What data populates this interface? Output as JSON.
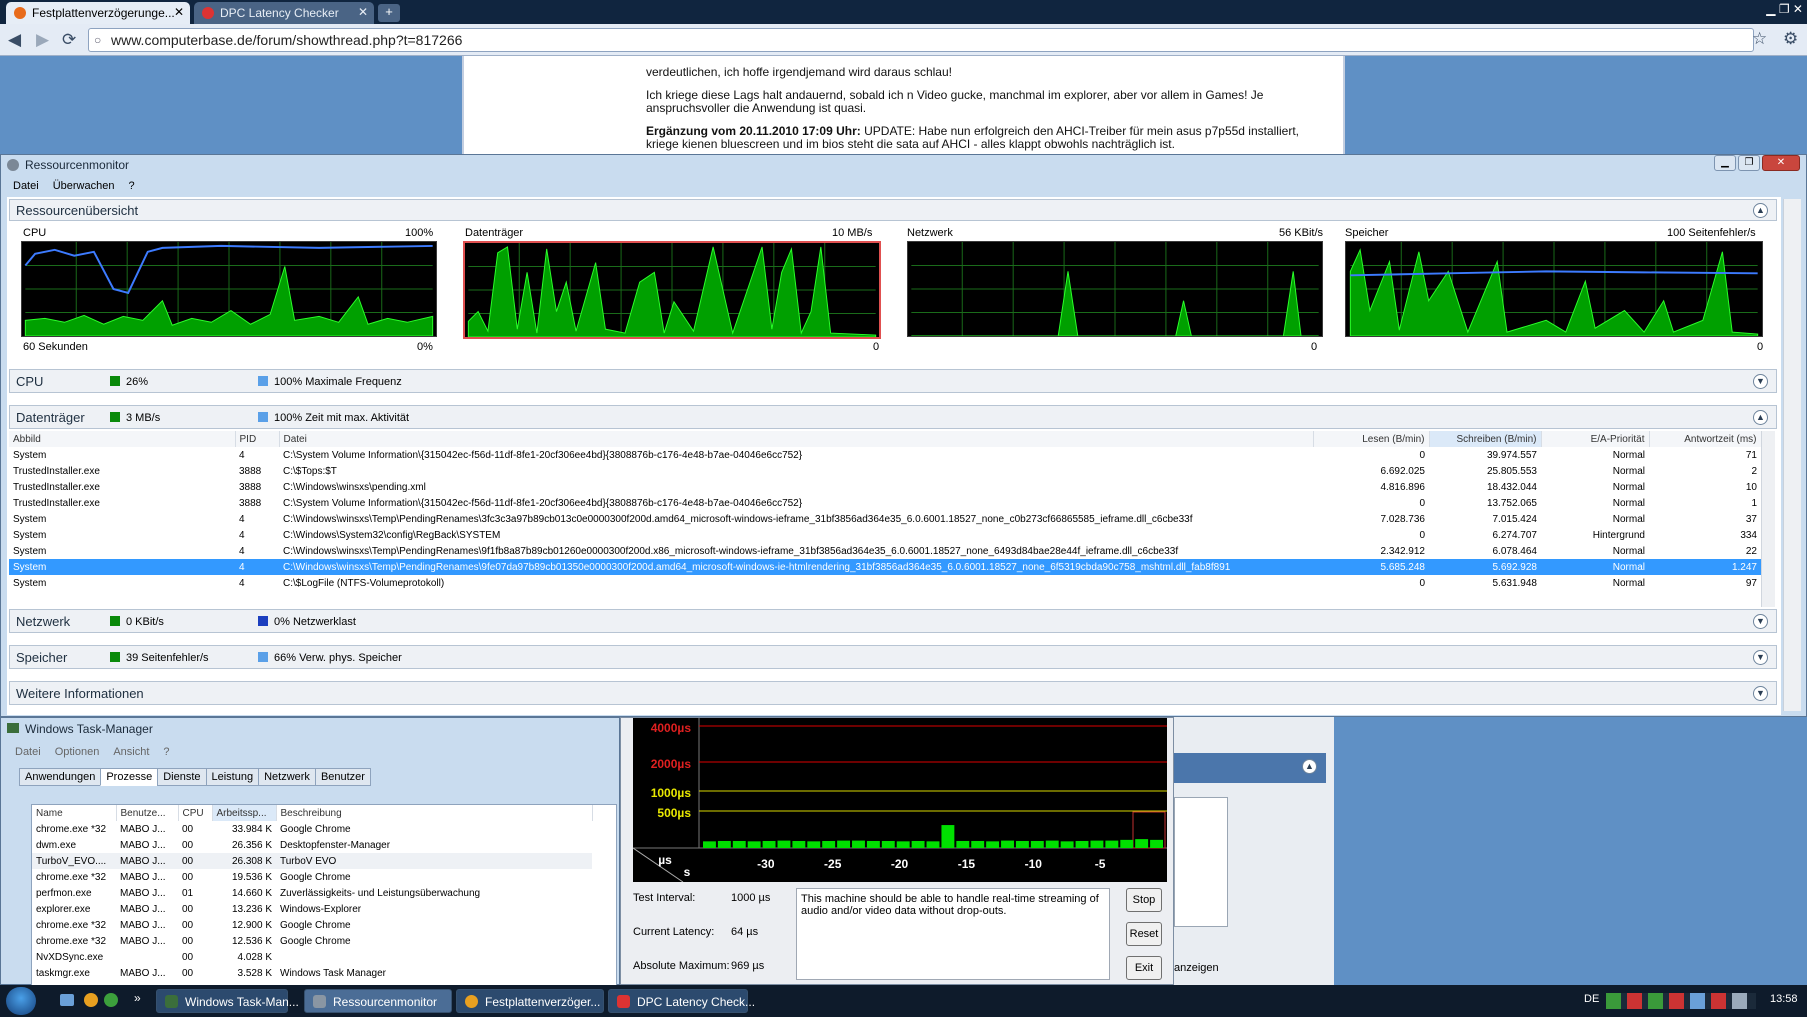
{
  "browser": {
    "tabs": [
      {
        "label": "Festplattenverzögerunge...",
        "active": true
      },
      {
        "label": "DPC Latency Checker",
        "active": false
      }
    ],
    "new_tab": "+",
    "url": "www.computerbase.de/forum/showthread.php?t=817266"
  },
  "forum": {
    "line1": "verdeutlichen, ich hoffe irgendjemand wird daraus schlau!",
    "para2": "Ich kriege diese Lags halt andauernd, sobald ich n Video gucke, manchmal im explorer, aber vor allem in Games! Je anspruchsvoller die Anwendung ist quasi.",
    "update_label": "Ergänzung vom 20.11.2010 17:09 Uhr:",
    "update_text": "UPDATE: Habe nun erfolgreich den AHCI-Treiber für mein asus p7p55d installiert, kriege kienen bluescreen und im bios steht die sata auf AHCI - alles klappt obwohls nachträglich ist."
  },
  "resmon": {
    "title": "Ressourcenmonitor",
    "menu": [
      "Datei",
      "Überwachen",
      "?"
    ],
    "overview_title": "Ressourcenübersicht",
    "graphs": [
      {
        "name": "CPU",
        "max": "100%",
        "footer_left": "60 Sekunden",
        "footer_right": "0%"
      },
      {
        "name": "Datenträger",
        "max": "10 MB/s",
        "footer_left": "",
        "footer_right": "0"
      },
      {
        "name": "Netzwerk",
        "max": "56 KBit/s",
        "footer_left": "",
        "footer_right": "0"
      },
      {
        "name": "Speicher",
        "max": "100 Seitenfehler/s",
        "footer_left": "",
        "footer_right": "0"
      }
    ],
    "cpu": {
      "title": "CPU",
      "stat1": "26%",
      "stat2": "100% Maximale Frequenz"
    },
    "disk": {
      "title": "Datenträger",
      "stat1": "3 MB/s",
      "stat2": "100% Zeit mit max. Aktivität",
      "columns": [
        "Abbild",
        "PID",
        "Datei",
        "Lesen (B/min)",
        "Schreiben (B/min)",
        "E/A-Priorität",
        "Antwortzeit (ms)"
      ],
      "rows": [
        [
          "System",
          "4",
          "C:\\System Volume Information\\{315042ec-f56d-11df-8fe1-20cf306ee4bd}{3808876b-c176-4e48-b7ae-04046e6cc752}",
          "0",
          "39.974.557",
          "Normal",
          "71"
        ],
        [
          "TrustedInstaller.exe",
          "3888",
          "C:\\$Tops:$T",
          "6.692.025",
          "25.805.553",
          "Normal",
          "2"
        ],
        [
          "TrustedInstaller.exe",
          "3888",
          "C:\\Windows\\winsxs\\pending.xml",
          "4.816.896",
          "18.432.044",
          "Normal",
          "10"
        ],
        [
          "TrustedInstaller.exe",
          "3888",
          "C:\\System Volume Information\\{315042ec-f56d-11df-8fe1-20cf306ee4bd}{3808876b-c176-4e48-b7ae-04046e6cc752}",
          "0",
          "13.752.065",
          "Normal",
          "1"
        ],
        [
          "System",
          "4",
          "C:\\Windows\\winsxs\\Temp\\PendingRenames\\3fc3c3a97b89cb013c0e0000300f200d.amd64_microsoft-windows-ieframe_31bf3856ad364e35_6.0.6001.18527_none_c0b273cf66865585_ieframe.dll_c6cbe33f",
          "7.028.736",
          "7.015.424",
          "Normal",
          "37"
        ],
        [
          "System",
          "4",
          "C:\\Windows\\System32\\config\\RegBack\\SYSTEM",
          "0",
          "6.274.707",
          "Hintergrund",
          "334"
        ],
        [
          "System",
          "4",
          "C:\\Windows\\winsxs\\Temp\\PendingRenames\\9f1fb8a87b89cb01260e0000300f200d.x86_microsoft-windows-ieframe_31bf3856ad364e35_6.0.6001.18527_none_6493d84bae28e44f_ieframe.dll_c6cbe33f",
          "2.342.912",
          "6.078.464",
          "Normal",
          "22"
        ],
        [
          "System",
          "4",
          "C:\\Windows\\winsxs\\Temp\\PendingRenames\\9fe07da97b89cb01350e0000300f200d.amd64_microsoft-windows-ie-htmlrendering_31bf3856ad364e35_6.0.6001.18527_none_6f5319cbda90c758_mshtml.dll_fab8f891",
          "5.685.248",
          "5.692.928",
          "Normal",
          "1.247"
        ],
        [
          "System",
          "4",
          "C:\\$LogFile (NTFS-Volumeprotokoll)",
          "0",
          "5.631.948",
          "Normal",
          "97"
        ]
      ],
      "selected_row": 7
    },
    "network": {
      "title": "Netzwerk",
      "stat1": "0 KBit/s",
      "stat2": "0% Netzwerklast"
    },
    "memory": {
      "title": "Speicher",
      "stat1": "39 Seitenfehler/s",
      "stat2": "66% Verw. phys. Speicher"
    },
    "more": "Weitere Informationen"
  },
  "taskmgr": {
    "title": "Windows Task-Manager",
    "menu": [
      "Datei",
      "Optionen",
      "Ansicht",
      "?"
    ],
    "tabs": [
      "Anwendungen",
      "Prozesse",
      "Dienste",
      "Leistung",
      "Netzwerk",
      "Benutzer"
    ],
    "active_tab": 1,
    "columns": [
      "Name",
      "Benutze...",
      "CPU",
      "Arbeitssp...",
      "Beschreibung"
    ],
    "rows": [
      [
        "chrome.exe *32",
        "MABO J...",
        "00",
        "33.984 K",
        "Google Chrome"
      ],
      [
        "dwm.exe",
        "MABO J...",
        "00",
        "26.356 K",
        "Desktopfenster-Manager"
      ],
      [
        "TurboV_EVO....",
        "MABO J...",
        "00",
        "26.308 K",
        "TurboV EVO"
      ],
      [
        "chrome.exe *32",
        "MABO J...",
        "00",
        "19.536 K",
        "Google Chrome"
      ],
      [
        "perfmon.exe",
        "MABO J...",
        "01",
        "14.660 K",
        "Zuverlässigkeits- und Leistungsüberwachung"
      ],
      [
        "explorer.exe",
        "MABO J...",
        "00",
        "13.236 K",
        "Windows-Explorer"
      ],
      [
        "chrome.exe *32",
        "MABO J...",
        "00",
        "12.900 K",
        "Google Chrome"
      ],
      [
        "chrome.exe *32",
        "MABO J...",
        "00",
        "12.536 K",
        "Google Chrome"
      ],
      [
        "NvXDSync.exe",
        "",
        "00",
        "4.028 K",
        ""
      ],
      [
        "taskmgr.exe",
        "MABO J...",
        "00",
        "3.528 K",
        "Windows Task Manager"
      ]
    ]
  },
  "dpc": {
    "y_labels": [
      "4000µs",
      "2000µs",
      "1000µs",
      "500µs"
    ],
    "unit_y": "µs",
    "unit_x": "s",
    "x_ticks": [
      "-30",
      "-25",
      "-20",
      "-15",
      "-10",
      "-5"
    ],
    "bars_us": [
      90,
      95,
      95,
      90,
      95,
      100,
      95,
      90,
      95,
      100,
      100,
      95,
      95,
      90,
      95,
      90,
      310,
      95,
      95,
      90,
      100,
      95,
      95,
      100,
      90,
      95,
      100,
      100,
      110,
      120,
      110
    ],
    "test_interval_label": "Test Interval:",
    "test_interval": "1000 µs",
    "current_label": "Current Latency:",
    "current": "64 µs",
    "max_label": "Absolute Maximum:",
    "max": "969 µs",
    "message": "This machine should be able to handle real-time streaming of audio and/or video data without drop-outs.",
    "buttons": [
      "Stop",
      "Reset",
      "Exit"
    ]
  },
  "behind": {
    "anzeigen": "anzeigen"
  },
  "taskbar": {
    "buttons": [
      "Windows Task-Man...",
      "Ressourcenmonitor",
      "Festplattenverzöger...",
      "DPC Latency Check..."
    ],
    "lang": "DE",
    "time": "13:58"
  },
  "colors": {
    "graph_green": "#00c800",
    "selection": "#3399ff",
    "dpc_bar": "#00e000"
  }
}
